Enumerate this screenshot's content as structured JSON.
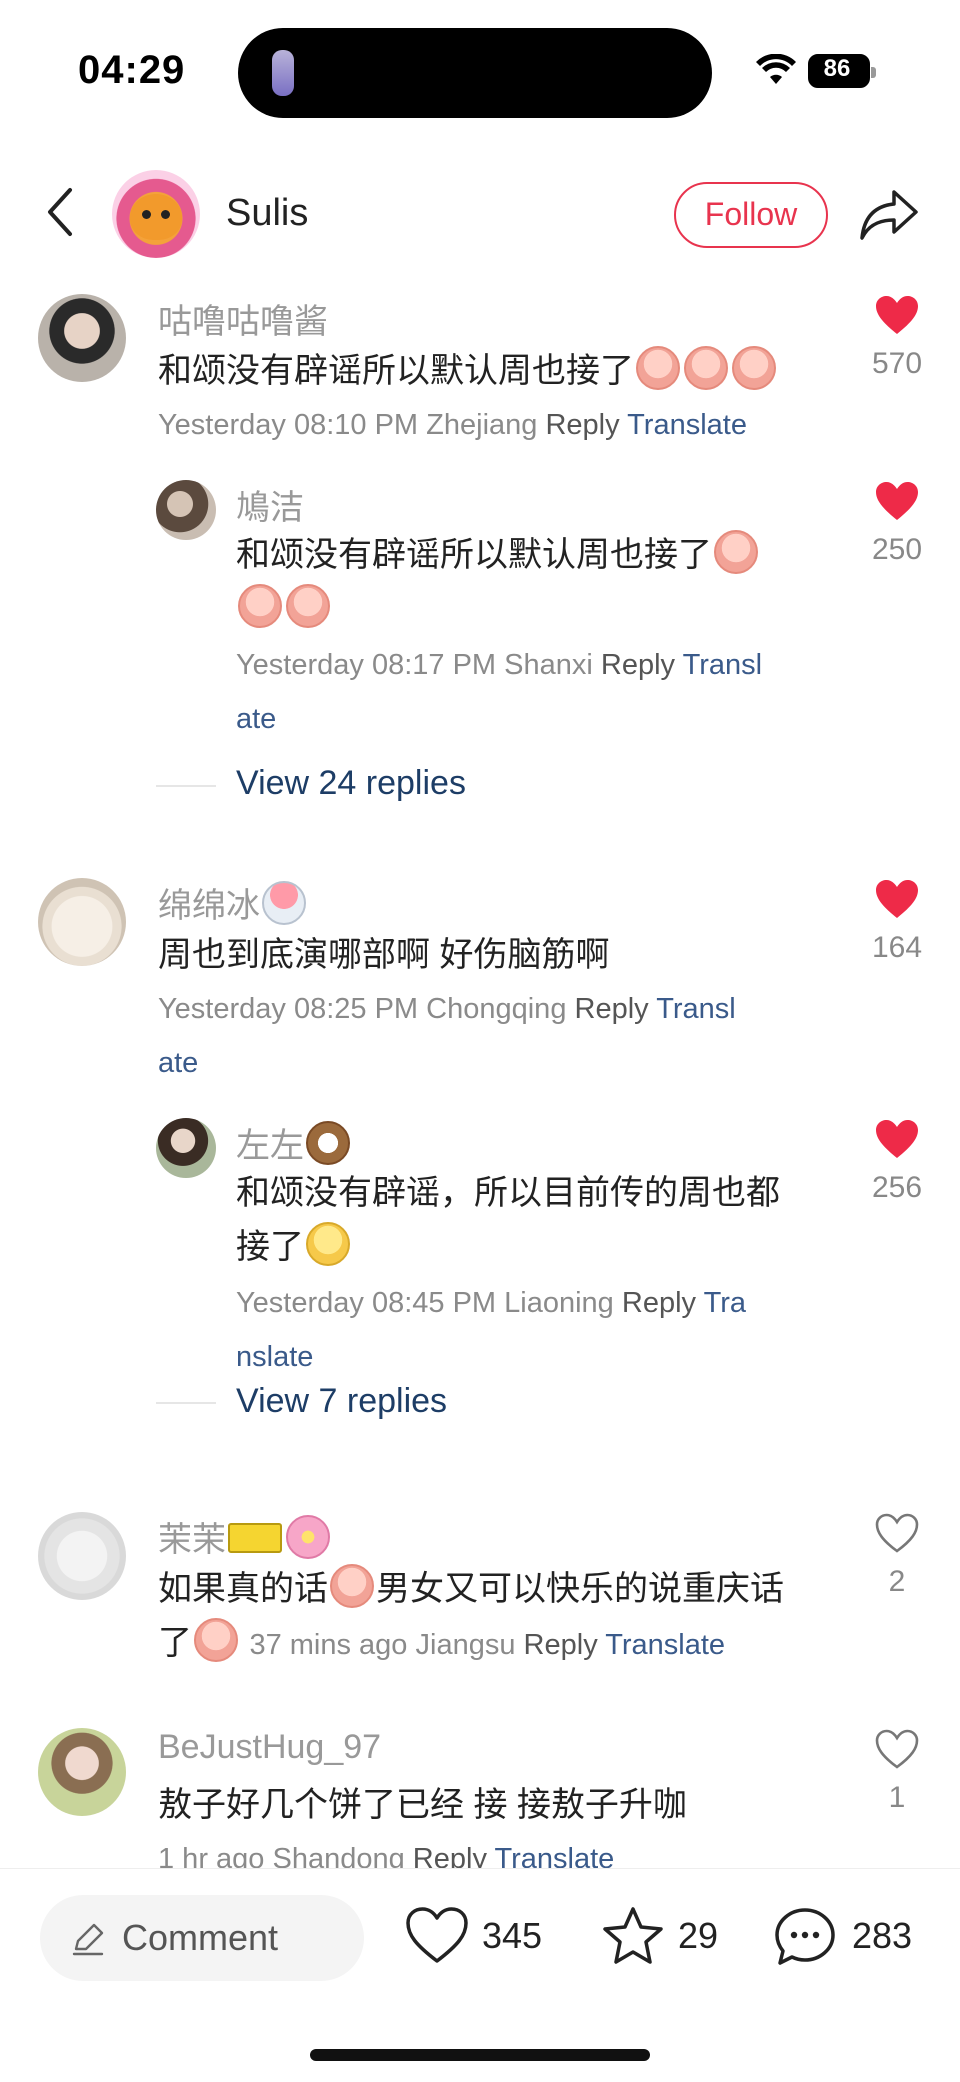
{
  "status_bar": {
    "time": "04:29",
    "battery": "86"
  },
  "header": {
    "author_name": "Sulis",
    "follow_label": "Follow"
  },
  "comments": [
    {
      "username": "咕噜咕噜酱",
      "text": "和颂没有辟谣所以默认周也接了",
      "time": "Yesterday 08:10 PM",
      "location": "Zhejiang",
      "reply_label": "Reply",
      "translate_label": "Translate",
      "likes": "570",
      "liked": true,
      "sub_reply": {
        "username": "鳩洁",
        "text": "和颂没有辟谣所以默认周也接了",
        "time": "Yesterday 08:17 PM",
        "location": "Shanxi",
        "reply_label": "Reply",
        "translate_label_1": "Transl",
        "translate_label_2": "ate",
        "likes": "250",
        "liked": true
      },
      "view_replies": "View 24 replies"
    },
    {
      "username": "绵绵冰",
      "text": "周也到底演哪部啊 好伤脑筋啊",
      "time": "Yesterday 08:25 PM",
      "location": "Chongqing",
      "reply_label": "Reply",
      "translate_label_1": "Transl",
      "translate_label_2": "ate",
      "likes": "164",
      "liked": true,
      "sub_reply": {
        "username": "左左",
        "text_line1": "和颂没有辟谣，所以目前传的周也都",
        "text_line2": "接了",
        "time": "Yesterday 08:45 PM",
        "location": "Liaoning",
        "reply_label": "Reply",
        "translate_label_1": "Tra",
        "translate_label_2": "nslate",
        "likes": "256",
        "liked": true
      },
      "view_replies": "View 7 replies"
    },
    {
      "username": "茉茉",
      "text_part1": "如果真的话",
      "text_part2": "男女又可以快乐的说重庆话",
      "text_part3": "了",
      "time": "37 mins ago",
      "location": "Jiangsu",
      "reply_label": "Reply",
      "translate_label": "Translate",
      "likes": "2",
      "liked": false
    },
    {
      "username": "BeJustHug_97",
      "text": "敖子好几个饼了已经 接 接敖子升咖",
      "time": "1 hr ago",
      "location": "Shandong",
      "reply_label": "Reply",
      "translate_label": "Translate",
      "likes": "1",
      "liked": false
    }
  ],
  "bottom_bar": {
    "comment_placeholder": "Comment",
    "likes": "345",
    "favorites": "29",
    "comments": "283"
  },
  "colors": {
    "accent_red": "#e8344e",
    "link_blue": "#3a5a8a"
  },
  "icons": [
    "back-arrow-icon",
    "share-icon",
    "heart-icon",
    "star-icon",
    "chat-bubble-icon",
    "pencil-icon",
    "wifi-icon",
    "battery-icon"
  ]
}
